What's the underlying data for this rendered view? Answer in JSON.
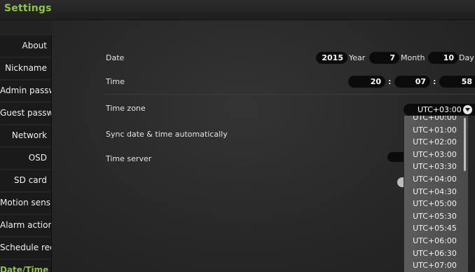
{
  "header": {
    "title": "Settings"
  },
  "sidebar": {
    "items": [
      {
        "label": "About"
      },
      {
        "label": "Nickname"
      },
      {
        "label": "Admin password"
      },
      {
        "label": "Guest password"
      },
      {
        "label": "Network"
      },
      {
        "label": "OSD"
      },
      {
        "label": "SD card"
      },
      {
        "label": "Motion sensitivity"
      },
      {
        "label": "Alarm action"
      },
      {
        "label": "Schedule recording"
      },
      {
        "label": "Date/Time",
        "active": true
      }
    ]
  },
  "datetime": {
    "date_label": "Date",
    "year": "2015",
    "year_unit": "Year",
    "month": "7",
    "month_unit": "Month",
    "day": "10",
    "day_unit": "Day",
    "time_label": "Time",
    "hour": "20",
    "minute": "07",
    "second": "58",
    "time_sep": ":",
    "timezone_label": "Time zone",
    "timezone_value": "UTC+03:00",
    "sync_label": "Sync date & time automatically",
    "server_label": "Time server"
  },
  "timezone_options": [
    "UTC+00:00",
    "UTC+01:00",
    "UTC+02:00",
    "UTC+03:00",
    "UTC+03:30",
    "UTC+04:00",
    "UTC+04:30",
    "UTC+05:00",
    "UTC+05:30",
    "UTC+05:45",
    "UTC+06:00",
    "UTC+06:30",
    "UTC+07:00"
  ],
  "colors": {
    "accent": "#8ec63f",
    "background": "#222222",
    "field": "#0b0b0b"
  }
}
